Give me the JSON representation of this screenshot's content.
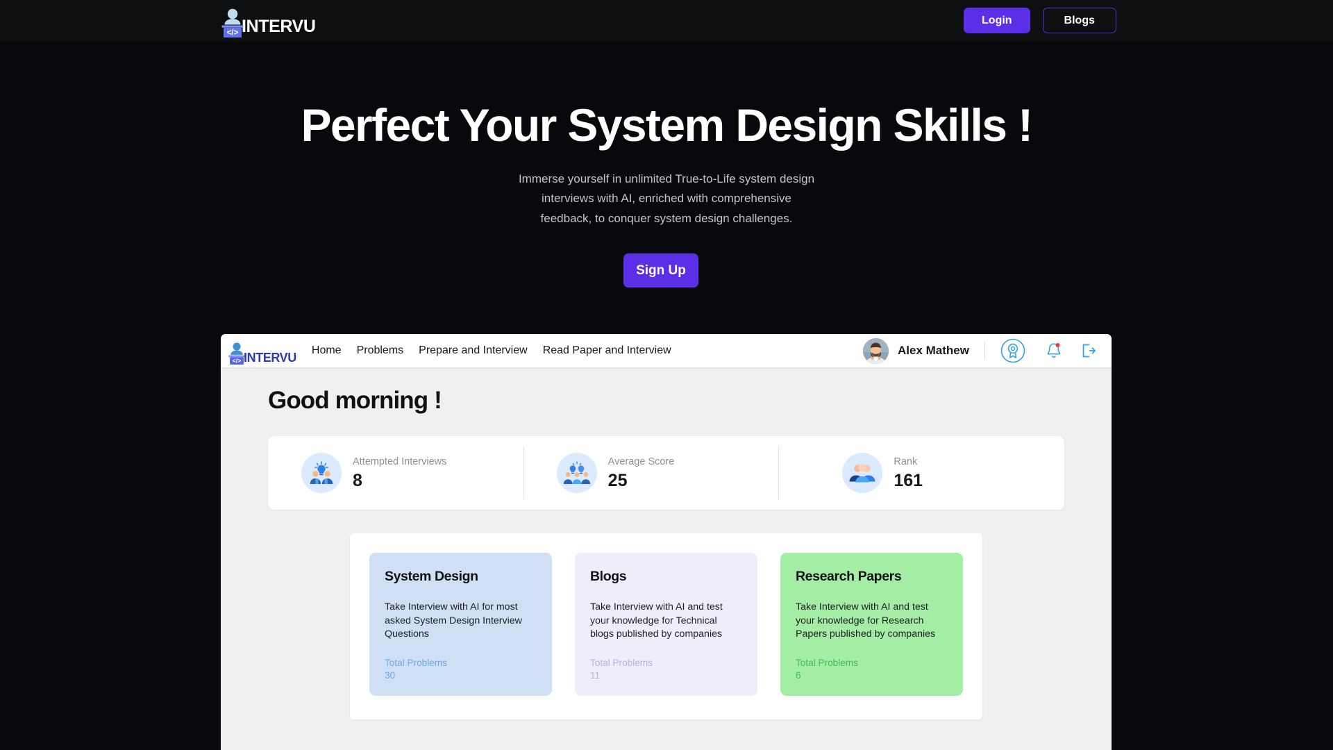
{
  "brand": {
    "name": "INTERVU",
    "mark_icon": "person-podium-code-icon"
  },
  "topnav": {
    "login_label": "Login",
    "blogs_label": "Blogs"
  },
  "hero": {
    "title": "Perfect Your System Design Skills !",
    "subtitle": "Immerse yourself in unlimited True-to-Life system design interviews with AI, enriched with comprehensive feedback, to conquer system design challenges.",
    "cta_label": "Sign Up"
  },
  "dashboard": {
    "brand_name": "INTERVU",
    "nav_links": [
      {
        "label": "Home"
      },
      {
        "label": "Problems"
      },
      {
        "label": "Prepare and Interview"
      },
      {
        "label": "Read Paper and Interview"
      }
    ],
    "user": {
      "name": "Alex Mathew",
      "avatar_icon": "user-avatar-photo"
    },
    "nav_icons": [
      {
        "name": "award-badge-icon"
      },
      {
        "name": "notification-bell-icon"
      },
      {
        "name": "logout-icon"
      }
    ],
    "greeting": "Good morning !",
    "stats": [
      {
        "label": "Attempted Interviews",
        "value": "8",
        "icon": "people-lightbulb-icon"
      },
      {
        "label": "Average Score",
        "value": "25",
        "icon": "group-lightbulbs-icon"
      },
      {
        "label": "Rank",
        "value": "161",
        "icon": "group-people-icon"
      }
    ],
    "cards": [
      {
        "title": "System Design",
        "description": "Take Interview with AI for most asked System Design Interview Questions",
        "meta_label": "Total Problems",
        "meta_value": "30"
      },
      {
        "title": "Blogs",
        "description": "Take Interview with AI and test your knowledge for Technical blogs published by companies",
        "meta_label": "Total Problems",
        "meta_value": "11"
      },
      {
        "title": "Research Papers",
        "description": "Take Interview with AI and test your knowledge for Research Papers published by companies",
        "meta_label": "Total Problems",
        "meta_value": "6"
      }
    ]
  },
  "colors": {
    "accent_purple": "#5b2ee8",
    "page_background": "#08090c",
    "topbar_background": "#0e0f11",
    "dashboard_background": "#f0f0f0",
    "card_system_design": "#cfe0f4",
    "card_blogs": "#eeeefb",
    "card_research_papers": "#a4eda4",
    "icon_blue": "#2ba3e8"
  }
}
